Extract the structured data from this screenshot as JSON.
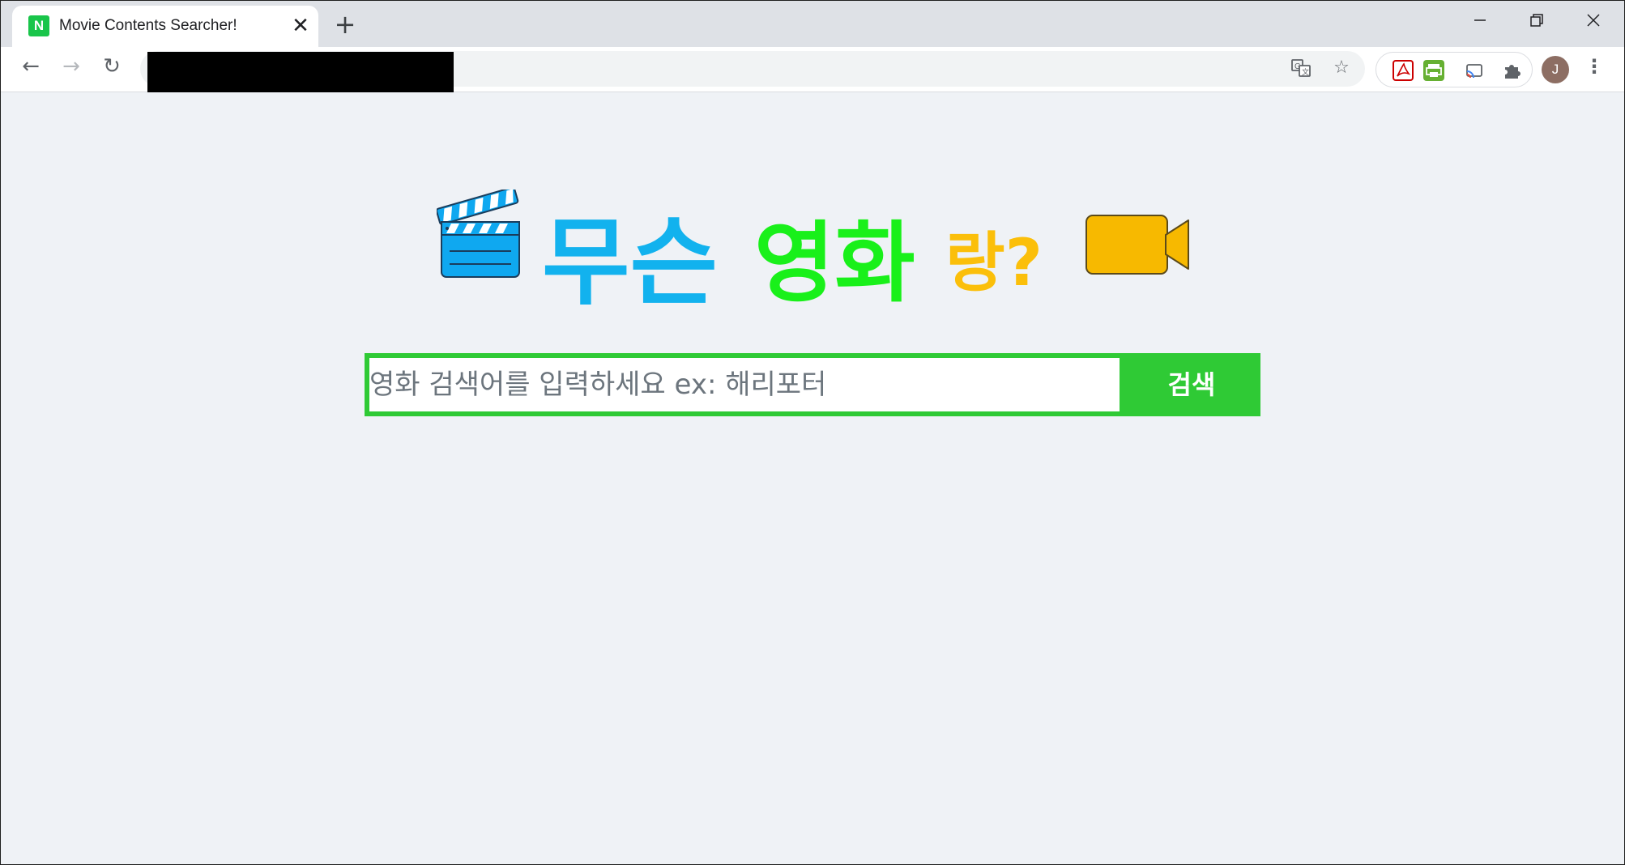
{
  "browser": {
    "tab": {
      "favicon_letter": "N",
      "title": "Movie Contents Searcher!"
    },
    "toolbar": {
      "avatar_letter": "J"
    }
  },
  "page": {
    "headline": {
      "word1": "무슨",
      "word2": "영화",
      "word3": "랑?",
      "colors": {
        "word1": "#12b2ee",
        "word2": "#19f01a",
        "word3": "#fbbf0a"
      }
    },
    "search": {
      "placeholder": "영화 검색어를 입력하세요 ex: 해리포터",
      "value": "",
      "button_label": "검색",
      "accent_color": "#2fca35"
    }
  }
}
